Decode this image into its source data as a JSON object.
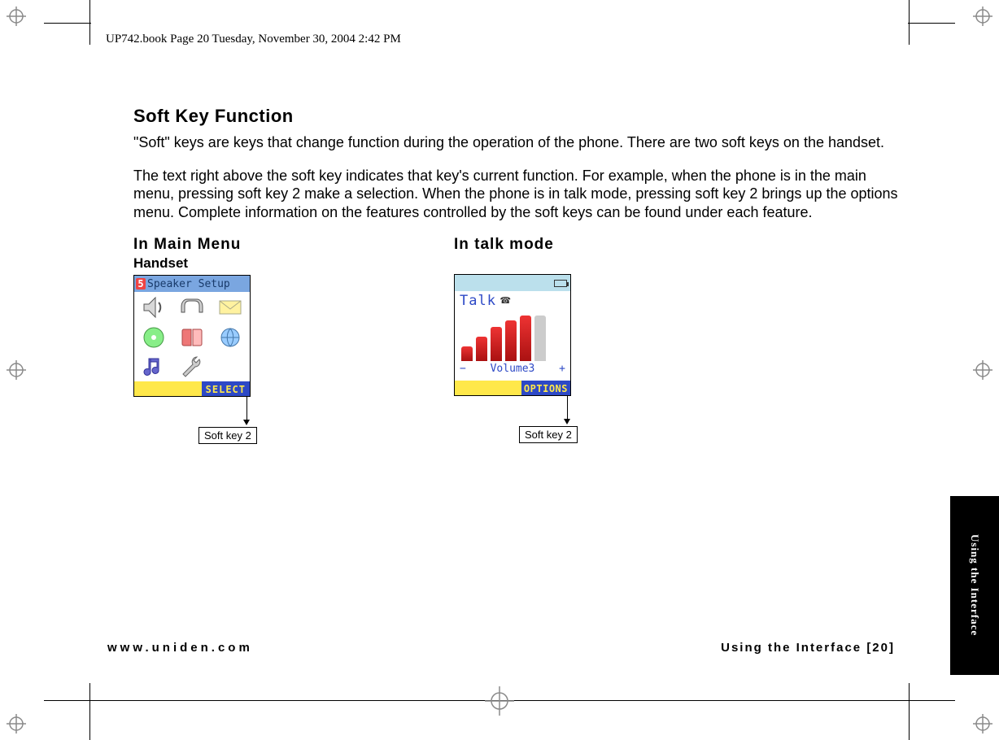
{
  "header_line": "UP742.book  Page 20  Tuesday, November 30, 2004  2:42 PM",
  "title": "Soft Key Function",
  "para1": "\"Soft\" keys are keys that change function during the operation of the phone. There are two soft keys on the handset.",
  "para2": "The text right above the soft key indicates that key's current function. For example, when the phone is in the main menu, pressing soft key 2 make a selection. When the phone is in talk mode, pressing soft key 2 brings up the options menu. Complete information on the features controlled by the soft keys can be found under each feature.",
  "examples": {
    "main_menu": {
      "heading": "In Main Menu",
      "subheading": "Handset",
      "screen": {
        "header_number": "5",
        "header_text": "Speaker Setup",
        "grid_icons": [
          "speaker-icon",
          "headset-icon",
          "envelope-icon",
          "globe-icon",
          "book-icon",
          "cd-icon",
          "music-note-icon",
          "wrench-icon",
          ""
        ],
        "footer_button": "SELECT"
      },
      "softkey_label": "Soft key 2"
    },
    "talk_mode": {
      "heading": "In talk mode",
      "screen": {
        "title": "Talk",
        "volume_label": "Volume3",
        "minus": "−",
        "plus": "+",
        "bars_active": 5,
        "bars_total": 6,
        "footer_button": "OPTIONS"
      },
      "softkey_label": "Soft key 2"
    }
  },
  "footer": {
    "left": "www.uniden.com",
    "right_section": "Using the Interface",
    "right_page": "[20]"
  },
  "side_tab": "Using the Interface"
}
